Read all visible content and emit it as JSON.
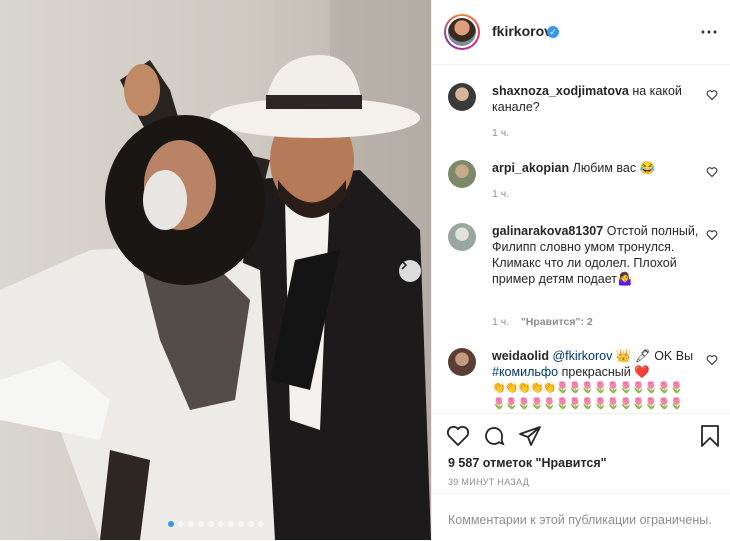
{
  "post": {
    "username": "fkirkorov",
    "verified_mark": "✓",
    "more_icon": "⋯",
    "likes": "9 587 отметок \"Нравится\"",
    "posted_ago": "39 МИНУТ НАЗАД",
    "comments_disabled": "Комментарии к этой публикации ограничены.",
    "carousel": {
      "total": 10,
      "active": 1
    }
  },
  "comments": [
    {
      "user": "shaxnoza_xodjimatova",
      "text": "на какой канале?",
      "time": "1 ч.",
      "likes": ""
    },
    {
      "user": "arpi_akopian",
      "text": "Любим вас 😂",
      "time": "1 ч.",
      "likes": ""
    },
    {
      "user": "galinarakova81307",
      "text": "Отстой полный, Филипп словно умом тронулся. Климакс что ли одолел. Плохой пример детям подает🤷‍♀️",
      "time": "1 ч.",
      "likes": "\"Нравится\": 2"
    },
    {
      "user": "weidaolid",
      "mention": "@fkirkorov",
      "text": " 👑 🖊 OK Вы ",
      "hashtag": "#комильфо",
      "text2": " прекрасный ❤️",
      "emoji_line1": "👏👏👏👏👏🌷🌷🌷🌷🌷🌷🌷🌷🌷🌷",
      "emoji_line2": "🌷🌷🌷🌷🌷🌷🌷🌷🌷🌷🌷🌷🌷🌷🌷"
    }
  ],
  "icons": [
    "heart-icon",
    "comment-icon",
    "share-icon",
    "bookmark-icon",
    "chevron-right-icon",
    "verified-icon",
    "more-icon"
  ],
  "colors": {
    "accent": "#3897f0",
    "text": "#262626",
    "muted": "#8e8e8e",
    "border": "#efefef"
  }
}
